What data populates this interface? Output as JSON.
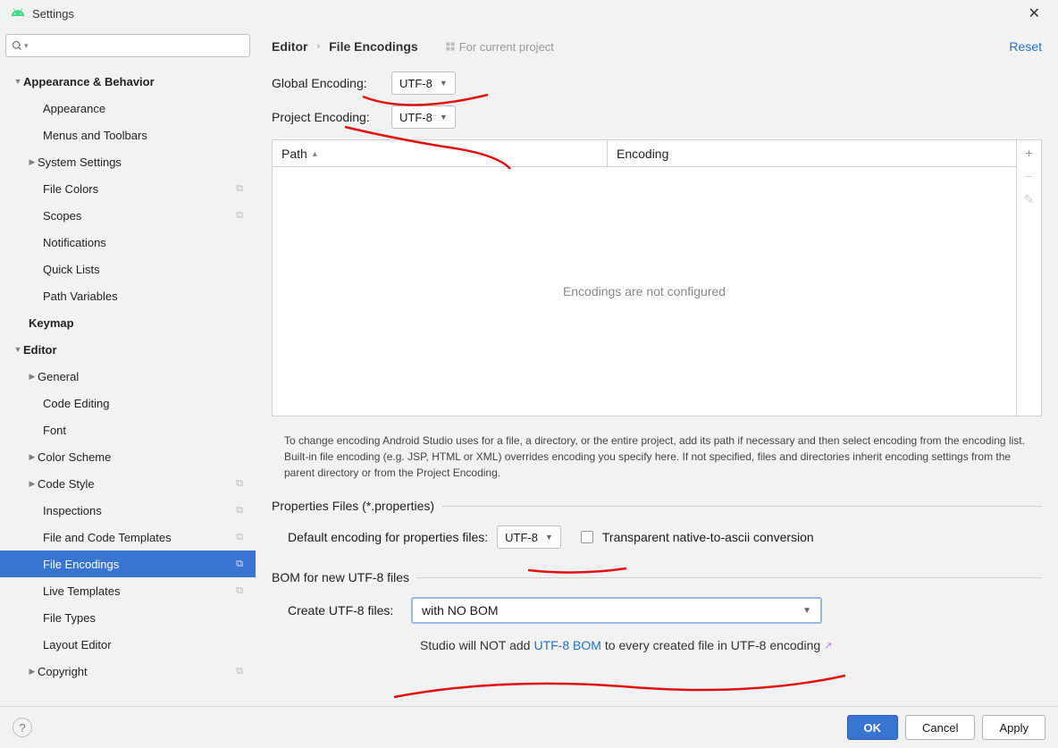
{
  "window": {
    "title": "Settings"
  },
  "search": {
    "placeholder": ""
  },
  "sidebar": {
    "items": [
      {
        "label": "Appearance & Behavior",
        "bold": true,
        "lvl": 0,
        "arrow": "down"
      },
      {
        "label": "Appearance",
        "lvl": 1
      },
      {
        "label": "Menus and Toolbars",
        "lvl": 1
      },
      {
        "label": "System Settings",
        "lvl": 1,
        "arrow": "right",
        "lvl1a": true
      },
      {
        "label": "File Colors",
        "lvl": 1,
        "copy": true
      },
      {
        "label": "Scopes",
        "lvl": 1,
        "copy": true
      },
      {
        "label": "Notifications",
        "lvl": 1
      },
      {
        "label": "Quick Lists",
        "lvl": 1
      },
      {
        "label": "Path Variables",
        "lvl": 1
      },
      {
        "label": "Keymap",
        "bold": true,
        "lvl": 0,
        "noarrow": true,
        "pad": true
      },
      {
        "label": "Editor",
        "bold": true,
        "lvl": 0,
        "arrow": "down"
      },
      {
        "label": "General",
        "lvl": 1,
        "arrow": "right",
        "lvl1a": true
      },
      {
        "label": "Code Editing",
        "lvl": 1
      },
      {
        "label": "Font",
        "lvl": 1
      },
      {
        "label": "Color Scheme",
        "lvl": 1,
        "arrow": "right",
        "lvl1a": true
      },
      {
        "label": "Code Style",
        "lvl": 1,
        "arrow": "right",
        "lvl1a": true,
        "copy": true
      },
      {
        "label": "Inspections",
        "lvl": 1,
        "copy": true
      },
      {
        "label": "File and Code Templates",
        "lvl": 1,
        "copy": true
      },
      {
        "label": "File Encodings",
        "lvl": 1,
        "selected": true,
        "copy": true
      },
      {
        "label": "Live Templates",
        "lvl": 1,
        "copy": true
      },
      {
        "label": "File Types",
        "lvl": 1
      },
      {
        "label": "Layout Editor",
        "lvl": 1
      },
      {
        "label": "Copyright",
        "lvl": 1,
        "arrow": "right",
        "lvl1a": true,
        "copy": true
      }
    ]
  },
  "breadcrumb": {
    "parent": "Editor",
    "current": "File Encodings",
    "for_project": "For current project"
  },
  "reset": "Reset",
  "global_encoding": {
    "label": "Global Encoding:",
    "value": "UTF-8"
  },
  "project_encoding": {
    "label": "Project Encoding:",
    "value": "UTF-8"
  },
  "table": {
    "col_path": "Path",
    "col_encoding": "Encoding",
    "empty": "Encodings are not configured"
  },
  "hint": "To change encoding Android Studio uses for a file, a directory, or the entire project, add its path if necessary and then select encoding from the encoding list. Built-in file encoding (e.g. JSP, HTML or XML) overrides encoding you specify here. If not specified, files and directories inherit encoding settings from the parent directory or from the Project Encoding.",
  "props_section": {
    "title": "Properties Files (*.properties)",
    "default_label": "Default encoding for properties files:",
    "default_value": "UTF-8",
    "transparent": "Transparent native-to-ascii conversion"
  },
  "bom_section": {
    "title": "BOM for new UTF-8 files",
    "create_label": "Create UTF-8 files:",
    "create_value": "with NO BOM",
    "hint_pre": "Studio will NOT add ",
    "hint_link": "UTF-8 BOM",
    "hint_post": " to every created file in UTF-8 encoding"
  },
  "footer": {
    "ok": "OK",
    "cancel": "Cancel",
    "apply": "Apply"
  }
}
